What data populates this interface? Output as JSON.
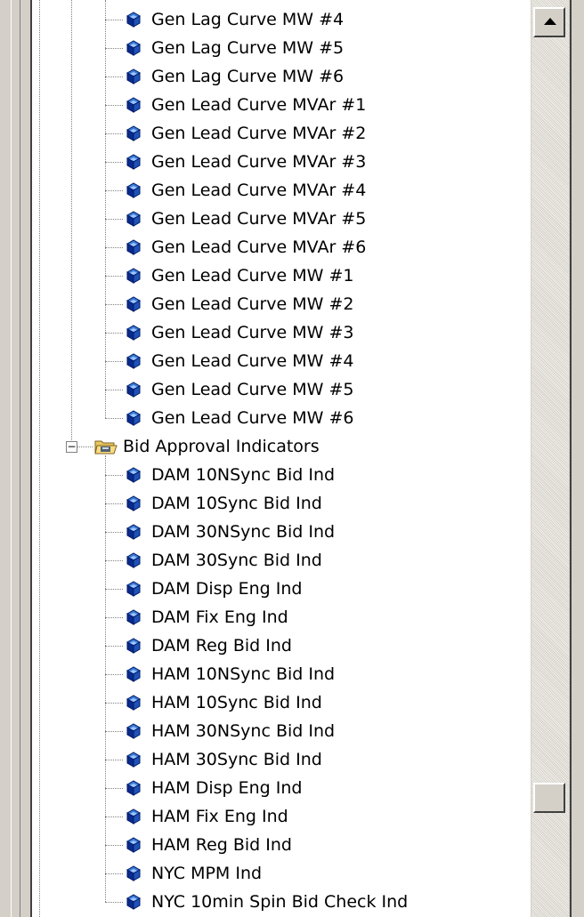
{
  "tree": {
    "curve_items": [
      "Gen Lag Curve MW #4",
      "Gen Lag Curve MW #5",
      "Gen Lag Curve MW #6",
      "Gen Lead Curve MVAr #1",
      "Gen Lead Curve MVAr #2",
      "Gen Lead Curve MVAr #3",
      "Gen Lead Curve MVAr #4",
      "Gen Lead Curve MVAr #5",
      "Gen Lead Curve MVAr #6",
      "Gen Lead Curve MW #1",
      "Gen Lead Curve MW #2",
      "Gen Lead Curve MW #3",
      "Gen Lead Curve MW #4",
      "Gen Lead Curve MW #5",
      "Gen Lead Curve MW #6"
    ],
    "folder": {
      "label": "Bid Approval Indicators",
      "toggle": "−",
      "expanded": true
    },
    "indicator_items": [
      "DAM 10NSync Bid Ind",
      "DAM 10Sync Bid Ind",
      "DAM 30NSync Bid Ind",
      "DAM 30Sync Bid Ind",
      "DAM Disp Eng Ind",
      "DAM Fix Eng Ind",
      "DAM Reg Bid Ind",
      "HAM 10NSync Bid Ind",
      "HAM 10Sync Bid Ind",
      "HAM 30NSync Bid Ind",
      "HAM 30Sync Bid Ind",
      "HAM Disp Eng Ind",
      "HAM Fix Eng Ind",
      "HAM Reg Bid Ind",
      "NYC MPM Ind",
      "NYC 10min Spin Bid Check Ind"
    ]
  },
  "icons": {
    "item": "cube-icon",
    "folder": "folder-icon"
  },
  "colors": {
    "cube_light": "#3a7bd5",
    "cube_dark": "#0a2a8c",
    "folder_yellow": "#e8c860"
  },
  "scrollbar": {
    "position_fraction": 0.9
  }
}
